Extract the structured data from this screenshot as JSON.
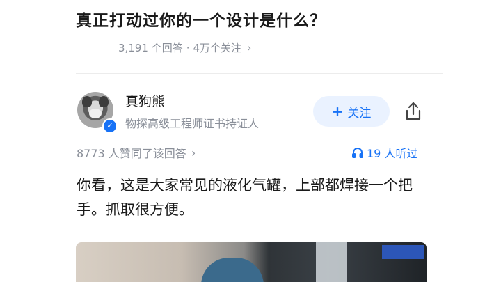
{
  "question": {
    "title": "真正打动过你的一个设计是什么？",
    "answers_count": "3,191 个回答",
    "separator": "·",
    "followers": "4万个关注",
    "chevron": "›"
  },
  "author": {
    "name": "真狗熊",
    "title": "物探高级工程师证书持证人",
    "verified_icon": "✓",
    "follow_plus": "+",
    "follow_label": "关注"
  },
  "answer": {
    "upvotes": "8773 人赞同了该回答",
    "upvotes_chevron": "›",
    "listen_count": "19 人听过",
    "body": "你看，这是大家常见的液化气罐，上部都焊接一个把手。抓取很方便。"
  },
  "icons": {
    "share": "share-icon",
    "headphone": "headphone-icon"
  },
  "colors": {
    "accent": "#1772f6",
    "follow_bg": "#eaf2ff",
    "muted": "#8a8f99"
  }
}
